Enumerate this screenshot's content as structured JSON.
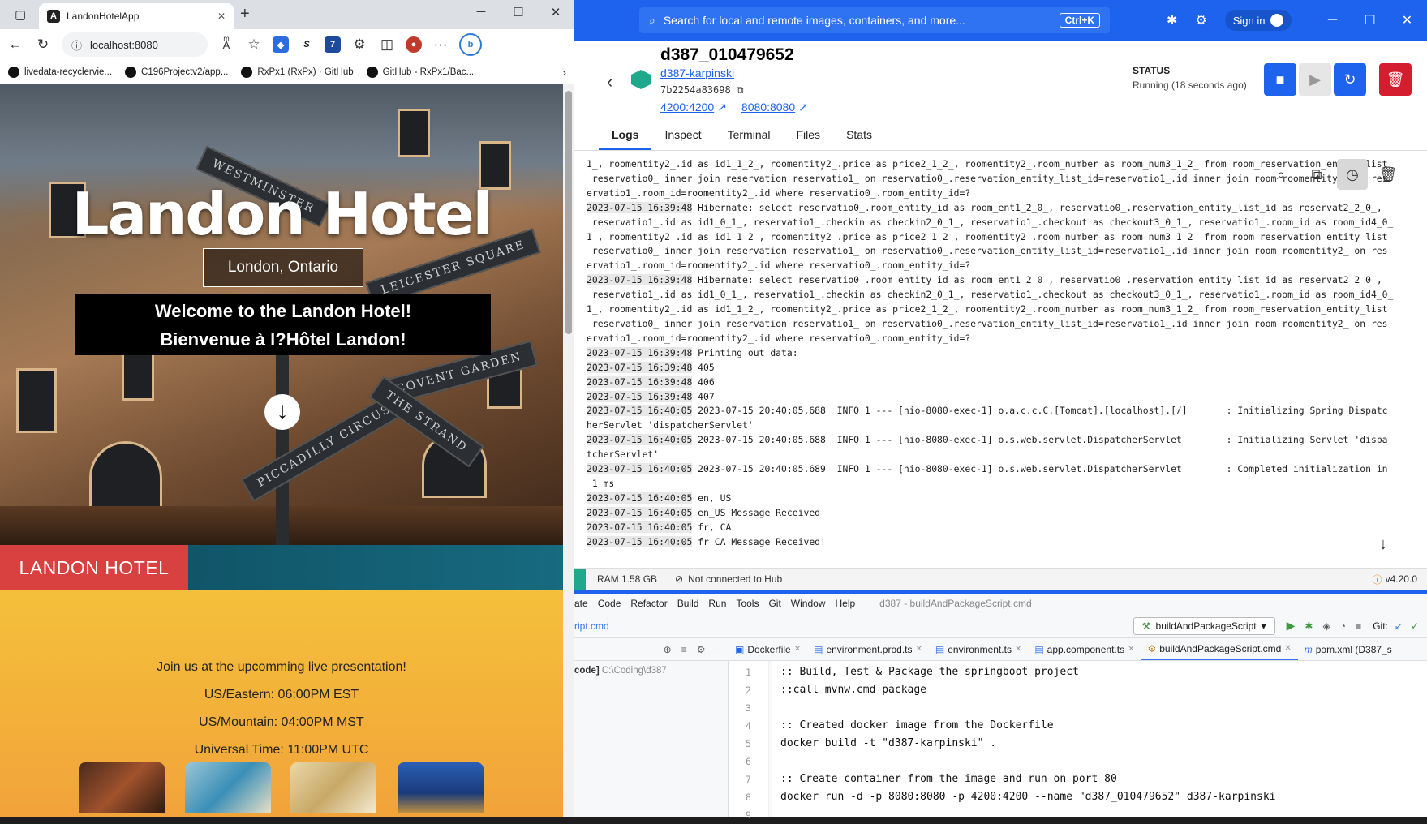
{
  "browser": {
    "tab_title": "LandonHotelApp",
    "tab_icon": "angular-icon",
    "url": "localhost:8080",
    "bookmarks": [
      "livedata-recyclervie...",
      "C196Projectv2/app...",
      "RxPx1 (RxPx) · GitHub",
      "GitHub - RxPx1/Bac..."
    ]
  },
  "hotel": {
    "title": "Landon Hotel",
    "subtitle": "London, Ontario",
    "welcome_en": "Welcome to the Landon Hotel!",
    "welcome_fr": "Bienvenue à l?Hôtel Landon!",
    "sign_texts": [
      "LEICESTER SQUARE",
      "COVENT GARDEN",
      "PICCADILLY CIRCUS",
      "WESTMINSTER",
      "THE STRAND"
    ],
    "brand": "LANDON HOTEL",
    "promo_intro": "Join us at the upcomming live presentation!",
    "times": [
      "US/Eastern: 06:00PM EST",
      "US/Mountain: 04:00PM MST",
      "Universal Time: 11:00PM UTC"
    ],
    "colors": {
      "brand_red": "#d8413f",
      "nav_teal": "#0d4a5c",
      "promo_yellow": "#f4c03b"
    }
  },
  "docker": {
    "search_placeholder": "Search for local and remote images, containers, and more...",
    "search_shortcut": "Ctrl+K",
    "sign_in": "Sign in",
    "container_name": "d387_010479652",
    "image_name": "d387-karpinski",
    "container_id": "7b2254a83698",
    "ports": [
      "4200:4200",
      "8080:8080"
    ],
    "status_label": "STATUS",
    "status_value": "Running (18 seconds ago)",
    "tabs": [
      "Logs",
      "Inspect",
      "Terminal",
      "Files",
      "Stats"
    ],
    "active_tab": "Logs",
    "logs": [
      {
        "ts": "",
        "text": "1_, roomentity2_.id as id1_1_2_, roomentity2_.price as price2_1_2_, roomentity2_.room_number as room_num3_1_2_ from room_reservation_entity_list"
      },
      {
        "ts": "",
        "text": " reservatio0_ inner join reservation reservatio1_ on reservatio0_.reservation_entity_list_id=reservatio1_.id inner join room roomentity2_ on res"
      },
      {
        "ts": "",
        "text": "ervatio1_.room_id=roomentity2_.id where reservatio0_.room_entity_id=?"
      },
      {
        "ts": "2023-07-15 16:39:48",
        "text": " Hibernate: select reservatio0_.room_entity_id as room_ent1_2_0_, reservatio0_.reservation_entity_list_id as reservat2_2_0_,"
      },
      {
        "ts": "",
        "text": " reservatio1_.id as id1_0_1_, reservatio1_.checkin as checkin2_0_1_, reservatio1_.checkout as checkout3_0_1_, reservatio1_.room_id as room_id4_0_"
      },
      {
        "ts": "",
        "text": "1_, roomentity2_.id as id1_1_2_, roomentity2_.price as price2_1_2_, roomentity2_.room_number as room_num3_1_2_ from room_reservation_entity_list"
      },
      {
        "ts": "",
        "text": " reservatio0_ inner join reservation reservatio1_ on reservatio0_.reservation_entity_list_id=reservatio1_.id inner join room roomentity2_ on res"
      },
      {
        "ts": "",
        "text": "ervatio1_.room_id=roomentity2_.id where reservatio0_.room_entity_id=?"
      },
      {
        "ts": "2023-07-15 16:39:48",
        "text": " Hibernate: select reservatio0_.room_entity_id as room_ent1_2_0_, reservatio0_.reservation_entity_list_id as reservat2_2_0_,"
      },
      {
        "ts": "",
        "text": " reservatio1_.id as id1_0_1_, reservatio1_.checkin as checkin2_0_1_, reservatio1_.checkout as checkout3_0_1_, reservatio1_.room_id as room_id4_0_"
      },
      {
        "ts": "",
        "text": "1_, roomentity2_.id as id1_1_2_, roomentity2_.price as price2_1_2_, roomentity2_.room_number as room_num3_1_2_ from room_reservation_entity_list"
      },
      {
        "ts": "",
        "text": " reservatio0_ inner join reservation reservatio1_ on reservatio0_.reservation_entity_list_id=reservatio1_.id inner join room roomentity2_ on res"
      },
      {
        "ts": "",
        "text": "ervatio1_.room_id=roomentity2_.id where reservatio0_.room_entity_id=?"
      },
      {
        "ts": "2023-07-15 16:39:48",
        "text": " Printing out data:"
      },
      {
        "ts": "2023-07-15 16:39:48",
        "text": " 405"
      },
      {
        "ts": "2023-07-15 16:39:48",
        "text": " 406"
      },
      {
        "ts": "2023-07-15 16:39:48",
        "text": " 407"
      },
      {
        "ts": "2023-07-15 16:40:05",
        "text": " 2023-07-15 20:40:05.688  INFO 1 --- [nio-8080-exec-1] o.a.c.c.C.[Tomcat].[localhost].[/]       : Initializing Spring Dispatc"
      },
      {
        "ts": "",
        "text": "herServlet 'dispatcherServlet'"
      },
      {
        "ts": "2023-07-15 16:40:05",
        "text": " 2023-07-15 20:40:05.688  INFO 1 --- [nio-8080-exec-1] o.s.web.servlet.DispatcherServlet        : Initializing Servlet 'dispa"
      },
      {
        "ts": "",
        "text": "tcherServlet'"
      },
      {
        "ts": "2023-07-15 16:40:05",
        "text": " 2023-07-15 20:40:05.689  INFO 1 --- [nio-8080-exec-1] o.s.web.servlet.DispatcherServlet        : Completed initialization in"
      },
      {
        "ts": "",
        "text": " 1 ms"
      },
      {
        "ts": "2023-07-15 16:40:05",
        "text": " en, US"
      },
      {
        "ts": "2023-07-15 16:40:05",
        "text": " en_US Message Received"
      },
      {
        "ts": "2023-07-15 16:40:05",
        "text": " fr, CA"
      },
      {
        "ts": "2023-07-15 16:40:05",
        "text": " fr_CA Message Received!"
      }
    ],
    "footer": {
      "ram": "RAM 1.58 GB",
      "hub": "Not connected to Hub",
      "version": "v4.20.0"
    },
    "colors": {
      "blue": "#1d63ed",
      "red": "#d41d2e"
    }
  },
  "ide": {
    "menu": [
      "ate",
      "Code",
      "Refactor",
      "Build",
      "Run",
      "Tools",
      "Git",
      "Window",
      "Help"
    ],
    "file_title": "d387 - buildAndPackageScript.cmd",
    "breadcrumb_file": "ript.cmd",
    "run_config": "buildAndPackageScript",
    "git_label": "Git:",
    "tabs": [
      {
        "label": "Dockerfile",
        "active": false
      },
      {
        "label": "environment.prod.ts",
        "active": false
      },
      {
        "label": "environment.ts",
        "active": false
      },
      {
        "label": "app.component.ts",
        "active": false
      },
      {
        "label": "buildAndPackageScript.cmd",
        "active": true
      },
      {
        "label": "pom.xml (D387_s",
        "active": false
      }
    ],
    "project_root": "code]",
    "project_path": "C:\\Coding\\d387",
    "line_numbers": [
      "1",
      "2",
      "3",
      "4",
      "5",
      "6",
      "7",
      "8",
      "9"
    ],
    "code_lines": [
      ":: Build, Test & Package the springboot project",
      "::call mvnw.cmd package",
      "",
      ":: Created docker image from the Dockerfile",
      "docker build -t \"d387-karpinski\" .",
      "",
      ":: Create container from the image and run on port 80",
      "docker run -d -p 8080:8080 -p 4200:4200 --name \"d387_010479652\" d387-karpinski",
      ""
    ]
  }
}
